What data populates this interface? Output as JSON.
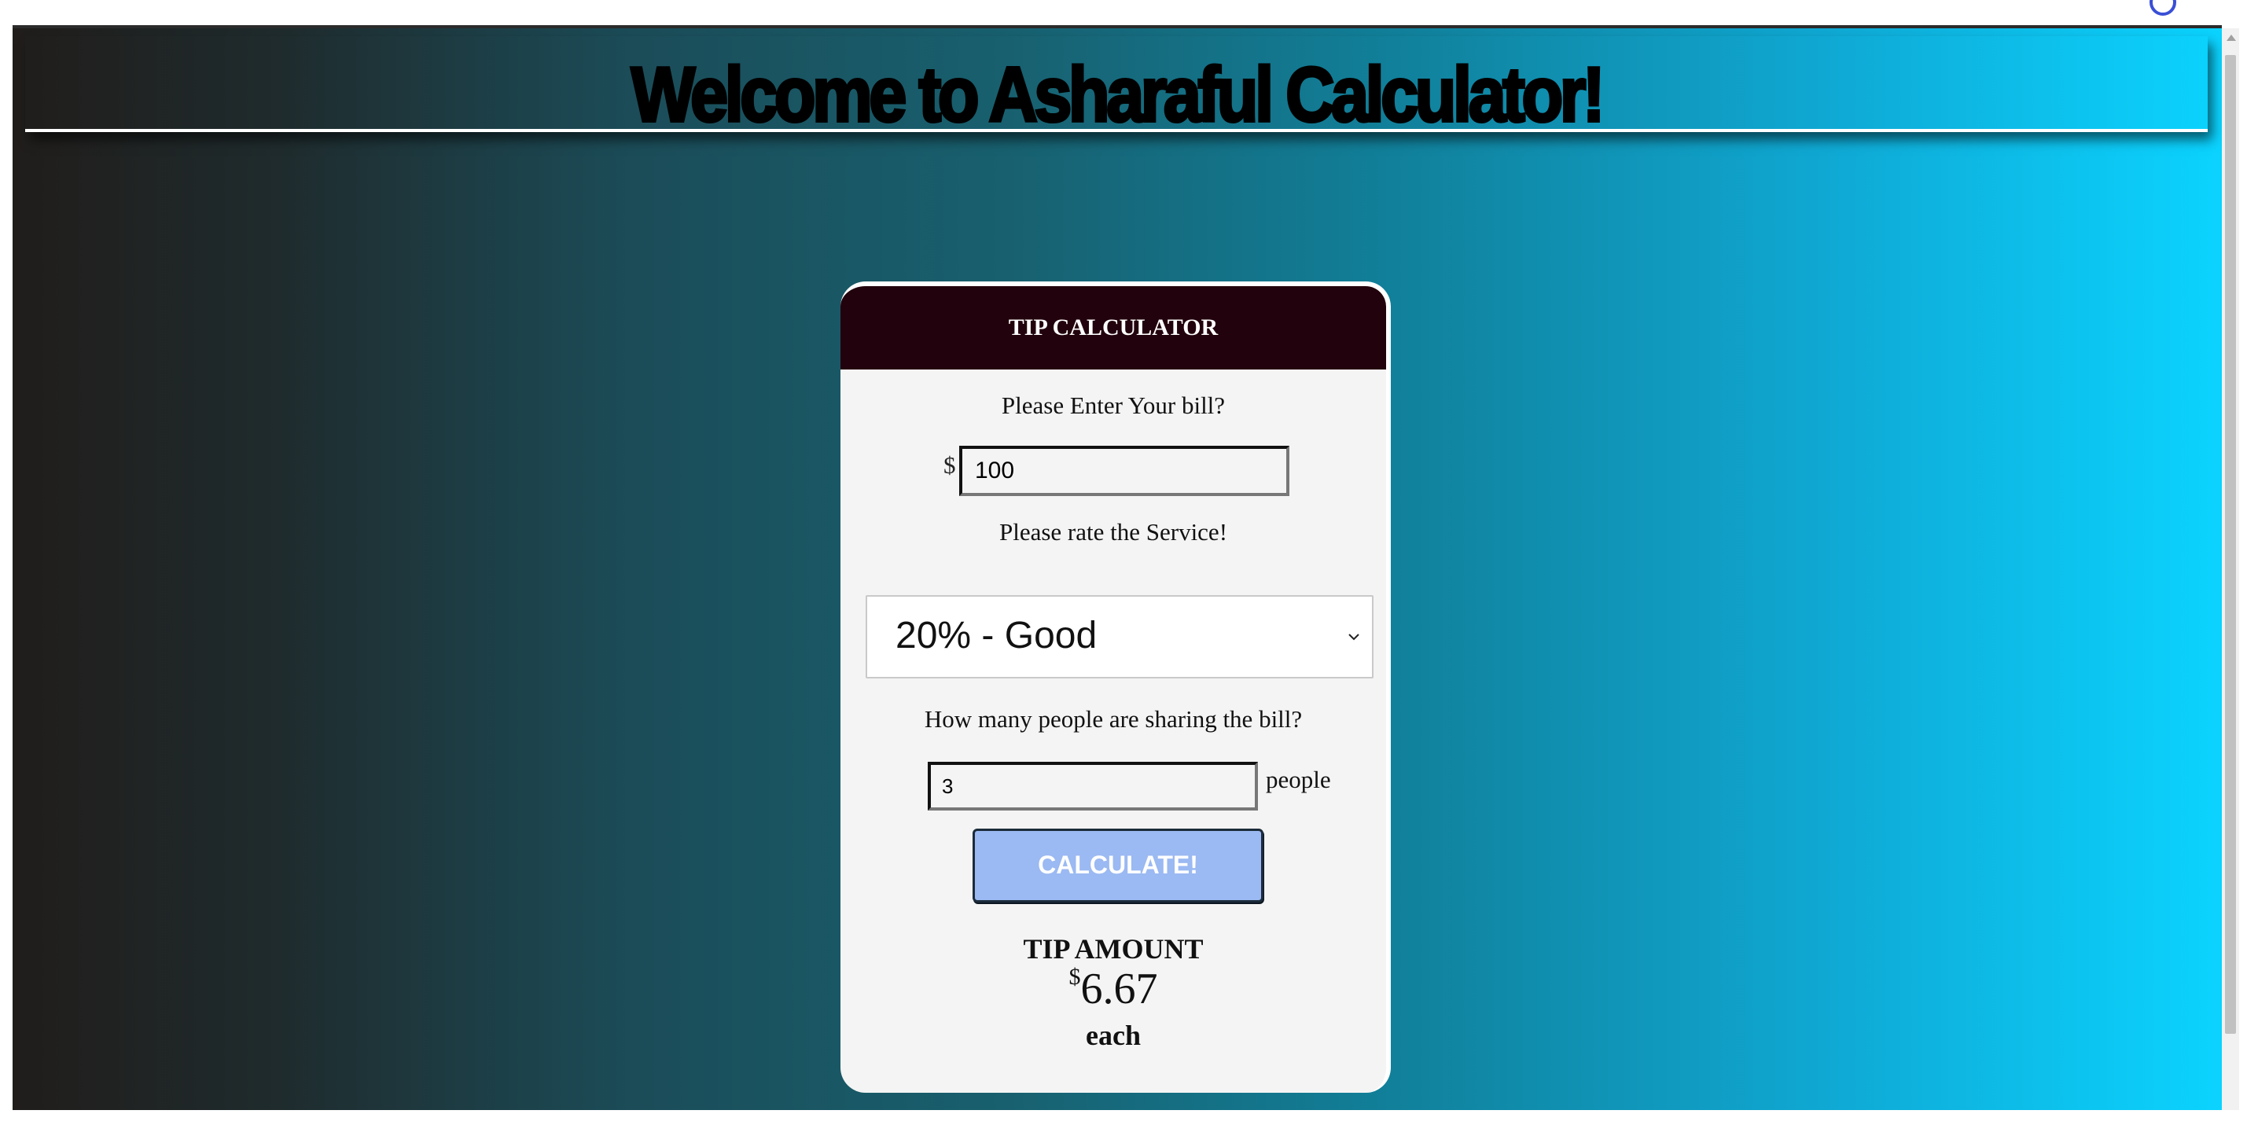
{
  "header": {
    "title": "Welcome to Asharaful Calculator!"
  },
  "calculator": {
    "title": "TIP CALCULATOR",
    "bill_prompt": "Please Enter Your bill?",
    "currency_symbol": "$",
    "bill_value": "100",
    "service_prompt": "Please rate the Service!",
    "service_selected": "20% - Good",
    "people_prompt": "How many people are sharing the bill?",
    "people_value": "3",
    "people_suffix": "people",
    "button_label": "CALCULATE!",
    "result_heading": "TIP AMOUNT",
    "result_currency": "$",
    "result_value": "6.67",
    "result_suffix": "each"
  },
  "icons": [
    "chevron-down-icon",
    "loading-ring-icon"
  ],
  "colors": {
    "card_header": "#22020c",
    "button": "#9bb9f2",
    "gradient_start": "#201d1b",
    "gradient_end": "#0bd3ff"
  }
}
